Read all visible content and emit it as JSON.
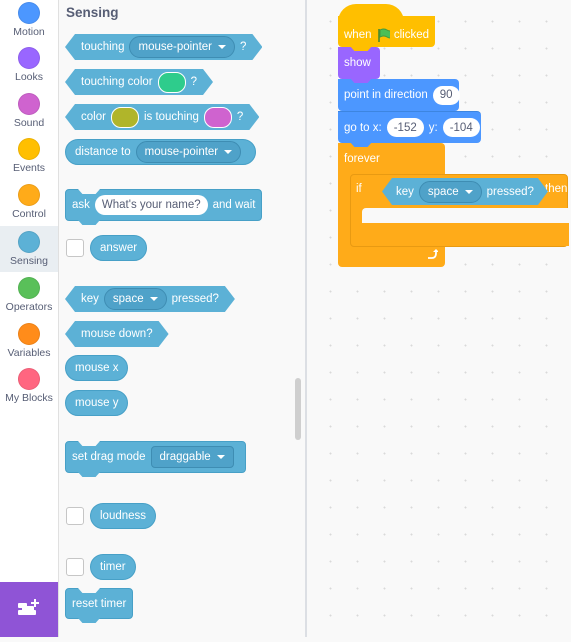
{
  "categories": [
    {
      "label": "Motion",
      "color": "#4c97ff",
      "selected": false
    },
    {
      "label": "Looks",
      "color": "#9966ff",
      "selected": false
    },
    {
      "label": "Sound",
      "color": "#cf63cf",
      "selected": false
    },
    {
      "label": "Events",
      "color": "#ffbf00",
      "selected": false
    },
    {
      "label": "Control",
      "color": "#ffab19",
      "selected": false
    },
    {
      "label": "Sensing",
      "color": "#5cb1d6",
      "selected": true
    },
    {
      "label": "Operators",
      "color": "#59c059",
      "selected": false
    },
    {
      "label": "Variables",
      "color": "#ff8c1a",
      "selected": false
    },
    {
      "label": "My Blocks",
      "color": "#ff6680",
      "selected": false
    }
  ],
  "extension_button": {
    "icon": "add-extension-icon"
  },
  "palette": {
    "title": "Sensing",
    "touching": {
      "label": "touching",
      "menu": "mouse-pointer",
      "suffix": "?"
    },
    "touching_color": {
      "label": "touching color",
      "color": "#2ecc8c",
      "suffix": "?"
    },
    "color_touching": {
      "label1": "color",
      "color1": "#b0b52a",
      "label2": "is touching",
      "color2": "#cf63cf",
      "suffix": "?"
    },
    "distance_to": {
      "label": "distance to",
      "menu": "mouse-pointer"
    },
    "ask": {
      "label": "ask",
      "input": "What's your name?",
      "suffix": "and wait"
    },
    "answer": {
      "label": "answer",
      "checked": false
    },
    "key_pressed": {
      "label": "key",
      "menu": "space",
      "suffix": "pressed?"
    },
    "mouse_down": {
      "label": "mouse down?"
    },
    "mouse_x": {
      "label": "mouse x"
    },
    "mouse_y": {
      "label": "mouse y"
    },
    "set_drag_mode": {
      "label": "set drag mode",
      "menu": "draggable"
    },
    "loudness": {
      "label": "loudness",
      "checked": false
    },
    "timer": {
      "label": "timer",
      "checked": false
    },
    "reset_timer": {
      "label": "reset timer"
    }
  },
  "script": {
    "when_flag": {
      "label1": "when",
      "label2": "clicked"
    },
    "show": {
      "label": "show"
    },
    "point_in_direction": {
      "label": "point in direction",
      "value": "90"
    },
    "go_to": {
      "label": "go to x:",
      "x": "-152",
      "ylabel": "y:",
      "y": "-104"
    },
    "forever": {
      "label": "forever"
    },
    "if_block": {
      "label": "if",
      "then": "then",
      "condition": {
        "label": "key",
        "menu": "space",
        "suffix": "pressed?"
      }
    }
  }
}
